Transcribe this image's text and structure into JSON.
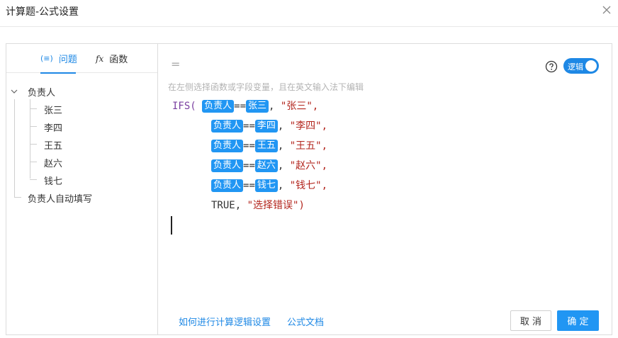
{
  "dialog": {
    "title": "计算题-公式设置"
  },
  "tabs": {
    "question_label": "问题",
    "function_label": "函数"
  },
  "tree": {
    "root_label": "负责人",
    "children": [
      "张三",
      "李四",
      "王五",
      "赵六",
      "钱七"
    ],
    "sibling_label": "负责人自动填写"
  },
  "editor": {
    "equals": "=",
    "hint": "在左侧选择函数或字段变量，且在英文输入法下编辑",
    "logic_toggle_label": "逻辑",
    "logic_toggle_on": true,
    "formula": {
      "fn_name": "IFS(",
      "field": "负责人",
      "op": "==",
      "lines": [
        {
          "value_tag": "张三",
          "result": "\"张三\","
        },
        {
          "value_tag": "李四",
          "result": "\"李四\","
        },
        {
          "value_tag": "王五",
          "result": "\"王五\","
        },
        {
          "value_tag": "赵六",
          "result": "\"赵六\","
        },
        {
          "value_tag": "钱七",
          "result": "\"钱七\","
        }
      ],
      "default_cond": "TRUE,",
      "default_result": "\"选择错误\")"
    }
  },
  "footer": {
    "link_logic": "如何进行计算逻辑设置",
    "link_doc": "公式文档",
    "cancel_label": "取 消",
    "ok_label": "确 定"
  },
  "colors": {
    "accent": "#2196f3",
    "string": "#b3261e",
    "function": "#7a3fa0"
  }
}
